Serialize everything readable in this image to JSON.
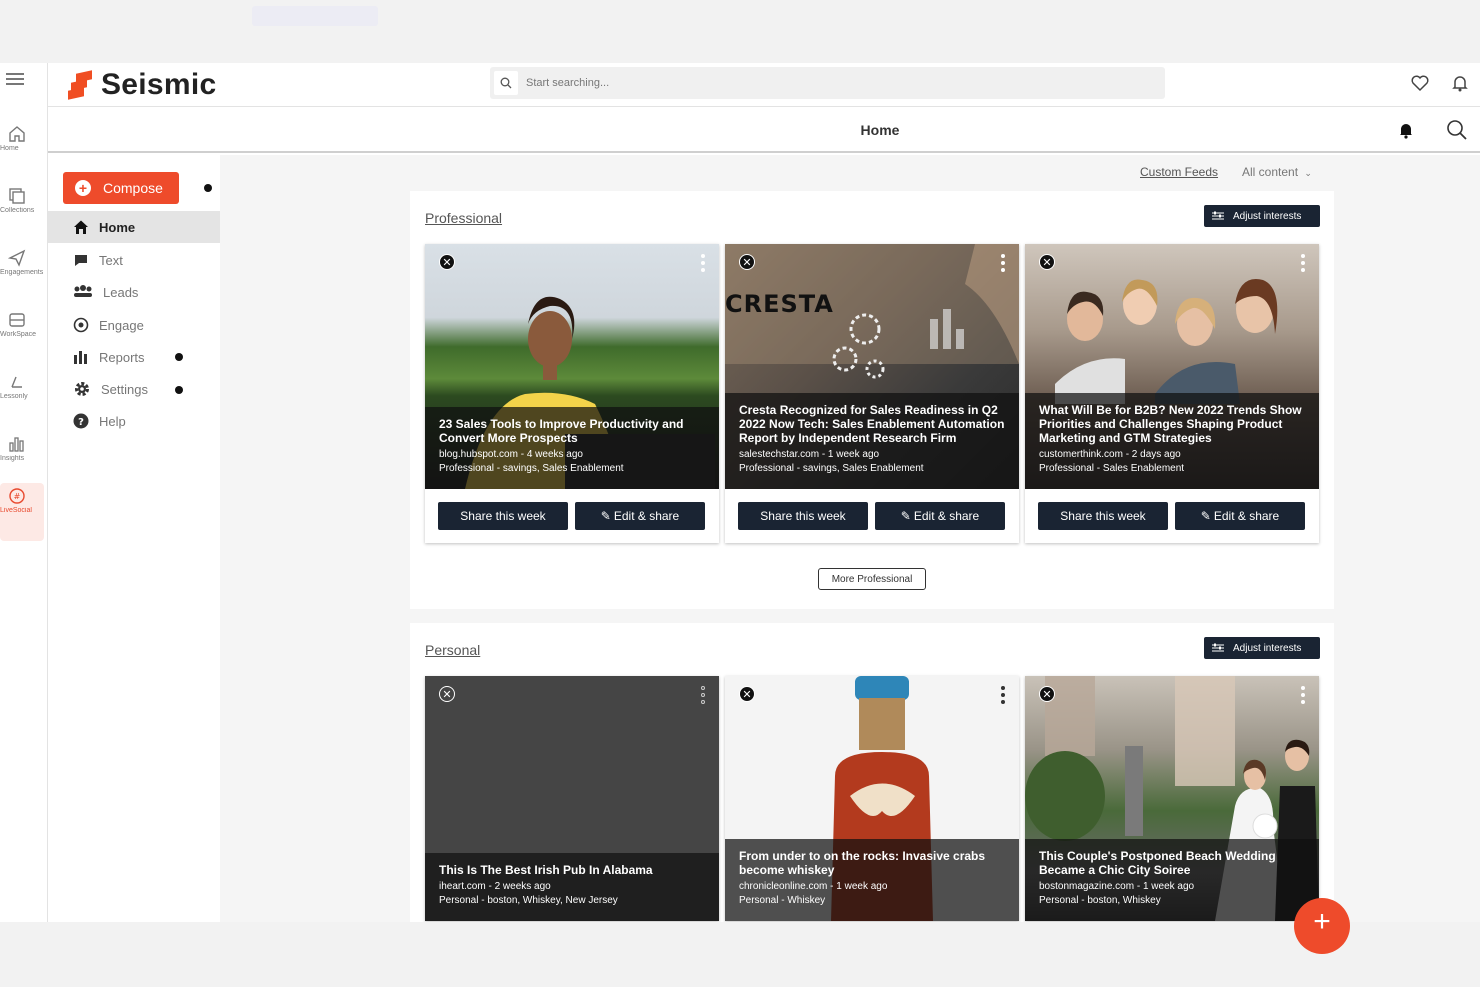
{
  "app": {
    "brand": "Seismic",
    "search_placeholder": "Start searching...",
    "page_title": "Home"
  },
  "rail": [
    {
      "label": "Home",
      "icon": "home-icon"
    },
    {
      "label": "Collections",
      "icon": "collections-icon"
    },
    {
      "label": "Engagements",
      "icon": "send-icon"
    },
    {
      "label": "WorkSpace",
      "icon": "workspace-icon"
    },
    {
      "label": "Lessonly",
      "icon": "lessonly-icon"
    },
    {
      "label": "Insights",
      "icon": "insights-icon"
    },
    {
      "label": "LiveSocial",
      "icon": "livesocial-icon"
    }
  ],
  "nav": {
    "compose_label": "Compose",
    "items": [
      {
        "label": "Home",
        "icon": "home-icon"
      },
      {
        "label": "Text",
        "icon": "chat-icon"
      },
      {
        "label": "Leads",
        "icon": "leads-icon"
      },
      {
        "label": "Engage",
        "icon": "engage-icon"
      },
      {
        "label": "Reports",
        "icon": "reports-icon"
      },
      {
        "label": "Settings",
        "icon": "gear-icon"
      },
      {
        "label": "Help",
        "icon": "help-icon"
      }
    ]
  },
  "feeds": {
    "custom_feeds": "Custom Feeds",
    "all_content": "All content"
  },
  "professional": {
    "title": "Professional",
    "adjust_label": "Adjust interests",
    "more_label": "More Professional",
    "cards": [
      {
        "title": "23 Sales Tools to Improve Productivity and Convert More Prospects",
        "meta": "blog.hubspot.com - 4 weeks ago",
        "category": "Professional - savings, Sales Enablement",
        "share": "Share this week",
        "edit": "Edit & share"
      },
      {
        "title": "Cresta Recognized for Sales Readiness in Q2 2022 Now Tech: Sales Enablement Automation Report by Independent Research Firm",
        "meta": "salestechstar.com - 1 week ago",
        "category": "Professional - savings, Sales Enablement",
        "image_text": "CRESTA",
        "share": "Share this week",
        "edit": "Edit & share"
      },
      {
        "title": "What Will Be for B2B? New 2022 Trends Show Priorities and Challenges Shaping Product Marketing and GTM Strategies",
        "meta": "customerthink.com - 2 days ago",
        "category": "Professional - Sales Enablement",
        "share": "Share this week",
        "edit": "Edit & share"
      }
    ]
  },
  "personal": {
    "title": "Personal",
    "adjust_label": "Adjust interests",
    "cards": [
      {
        "title": "This Is The Best Irish Pub In Alabama",
        "meta": "iheart.com - 2 weeks ago",
        "category": "Personal - boston, Whiskey, New Jersey"
      },
      {
        "title": "From under to on the rocks: Invasive crabs become whiskey",
        "meta": "chronicleonline.com - 1 week ago",
        "category": "Personal - Whiskey"
      },
      {
        "title": "This Couple's Postponed Beach Wedding Became a Chic City Soiree",
        "meta": "bostonmagazine.com - 1 week ago",
        "category": "Personal - boston, Whiskey"
      }
    ]
  },
  "colors": {
    "brand": "#ee4b2b",
    "button_dark": "#1a2433"
  }
}
